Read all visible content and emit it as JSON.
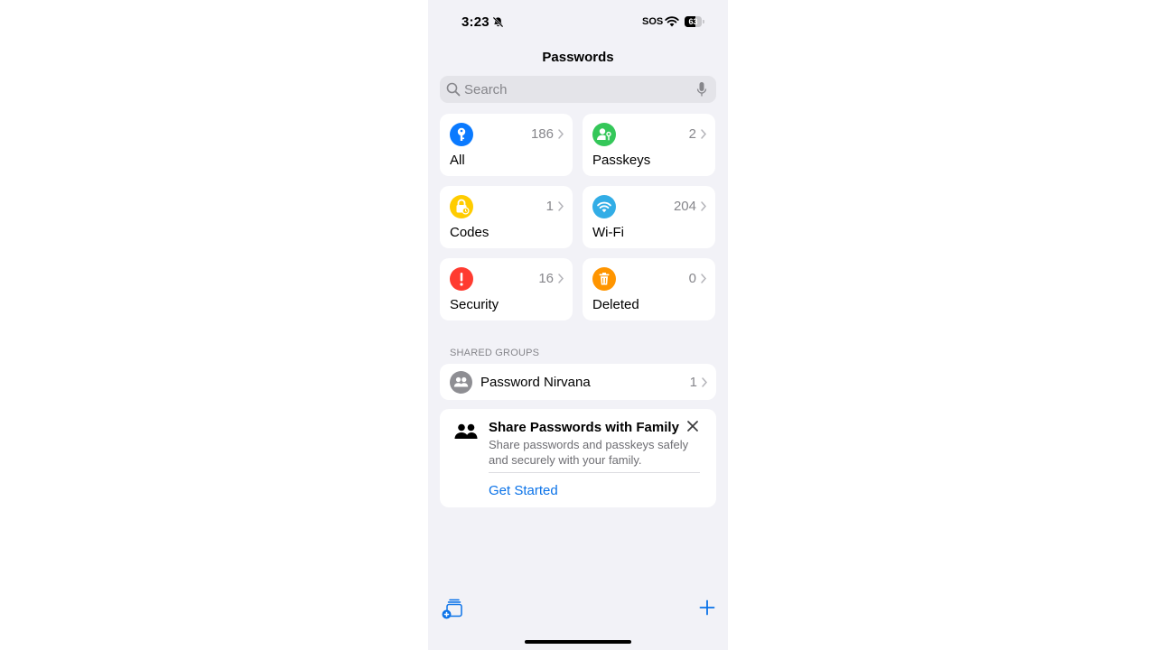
{
  "status_bar": {
    "time": "3:23",
    "sos": "SOS",
    "battery": "63",
    "battery_fraction": 0.63
  },
  "nav": {
    "title": "Passwords"
  },
  "search": {
    "placeholder": "Search",
    "value": ""
  },
  "colors": {
    "accent": "#0a72e8",
    "all": "#0a7aff",
    "passkeys": "#34c759",
    "codes": "#ffcc00",
    "wifi": "#32ade6",
    "security": "#ff3b30",
    "deleted": "#ff9500",
    "group_avatar": "#8e8e93"
  },
  "categories": [
    {
      "label": "All",
      "count": "186",
      "icon": "key-icon"
    },
    {
      "label": "Passkeys",
      "count": "2",
      "icon": "passkey-person-icon"
    },
    {
      "label": "Codes",
      "count": "1",
      "icon": "lock-clock-icon"
    },
    {
      "label": "Wi-Fi",
      "count": "204",
      "icon": "wifi-icon"
    },
    {
      "label": "Security",
      "count": "16",
      "icon": "exclamation-icon"
    },
    {
      "label": "Deleted",
      "count": "0",
      "icon": "trash-icon"
    }
  ],
  "shared_groups": {
    "header": "SHARED GROUPS",
    "items": [
      {
        "name": "Password Nirvana",
        "count": "1",
        "icon": "group-people-icon"
      }
    ]
  },
  "promo": {
    "title": "Share Passwords with Family",
    "body": "Share passwords and passkeys safely and securely with your family.",
    "action": "Get Started",
    "icon": "family-icon"
  },
  "toolbar": {
    "left_icon": "new-group-icon",
    "right_icon": "plus-icon"
  }
}
